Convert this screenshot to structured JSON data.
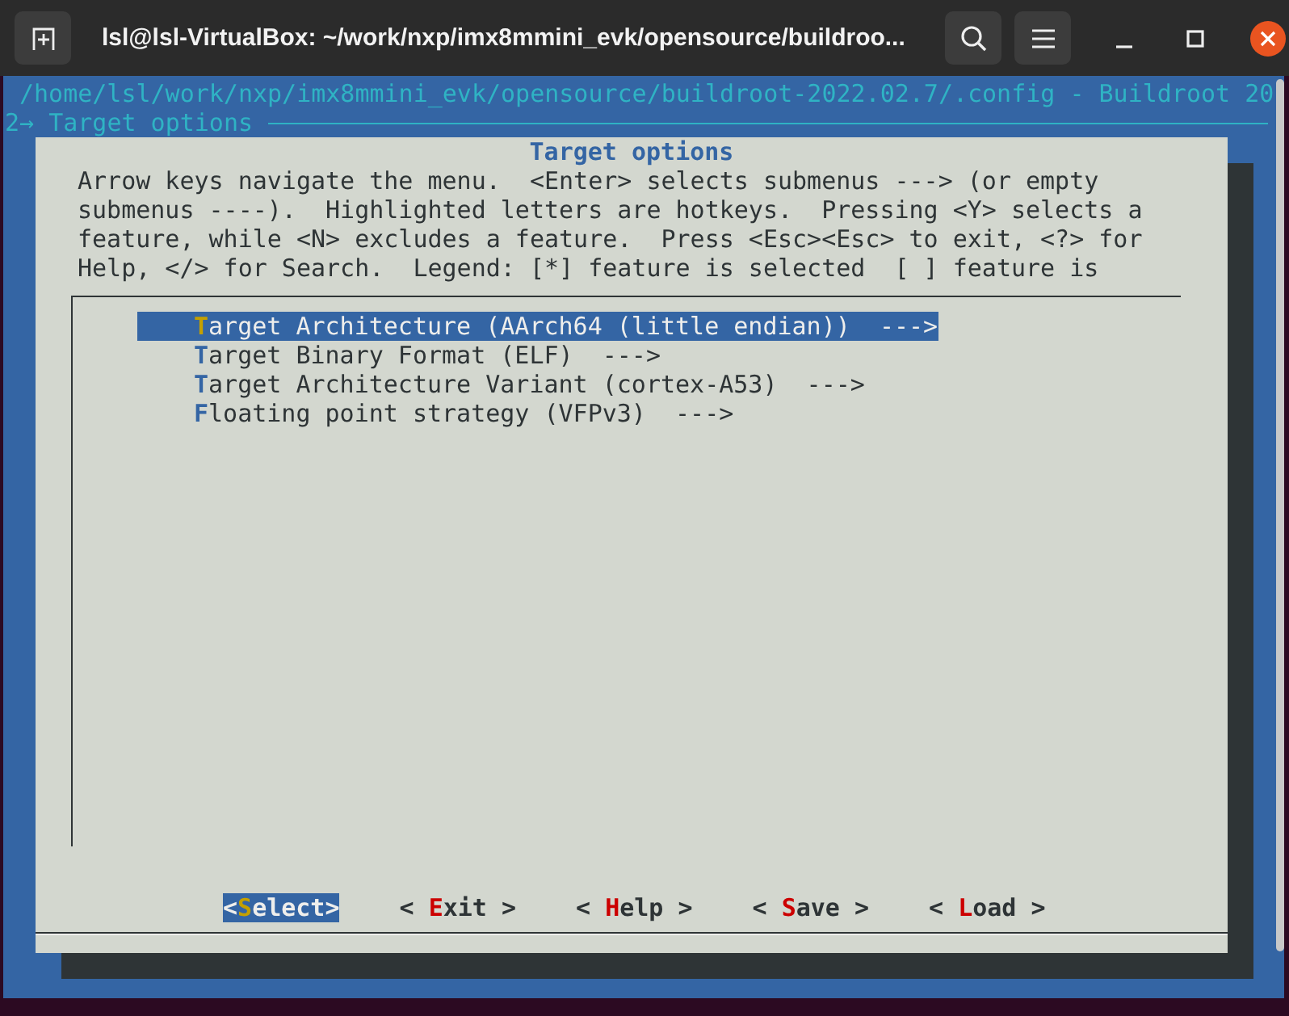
{
  "window": {
    "title": "lsl@lsl-VirtualBox: ~/work/nxp/imx8mmini_evk/opensource/buildroo..."
  },
  "terminal": {
    "header": "/home/lsl/work/nxp/imx8mmini_evk/opensource/buildroot-2022.02.7/.config - Buildroot 20",
    "breadcrumb": "2→ Target options"
  },
  "dialog": {
    "title": "Target options",
    "help_lines": [
      "Arrow keys navigate the menu.  <Enter> selects submenus ---> (or empty",
      "submenus ----).  Highlighted letters are hotkeys.  Pressing <Y> selects a",
      "feature, while <N> excludes a feature.  Press <Esc><Esc> to exit, <?> for",
      "Help, </> for Search.  Legend: [*] feature is selected  [ ] feature is"
    ],
    "items": [
      {
        "hotkey": "T",
        "rest": "arget Architecture (AArch64 (little endian))  --->",
        "selected": true
      },
      {
        "hotkey": "T",
        "rest": "arget Binary Format (ELF)  --->",
        "selected": false
      },
      {
        "hotkey": "T",
        "rest": "arget Architecture Variant (cortex-A53)  --->",
        "selected": false
      },
      {
        "hotkey": "F",
        "rest": "loating point strategy (VFPv3)  --->",
        "selected": false
      }
    ],
    "buttons": [
      {
        "open": "<",
        "hotkey": "S",
        "rest": "elect",
        "close": ">",
        "selected": true
      },
      {
        "open": "< ",
        "hotkey": "E",
        "rest": "xit",
        "close": " >",
        "selected": false
      },
      {
        "open": "< ",
        "hotkey": "H",
        "rest": "elp",
        "close": " >",
        "selected": false
      },
      {
        "open": "< ",
        "hotkey": "S",
        "rest": "ave",
        "close": " >",
        "selected": false
      },
      {
        "open": "< ",
        "hotkey": "L",
        "rest": "oad",
        "close": " >",
        "selected": false
      }
    ]
  }
}
